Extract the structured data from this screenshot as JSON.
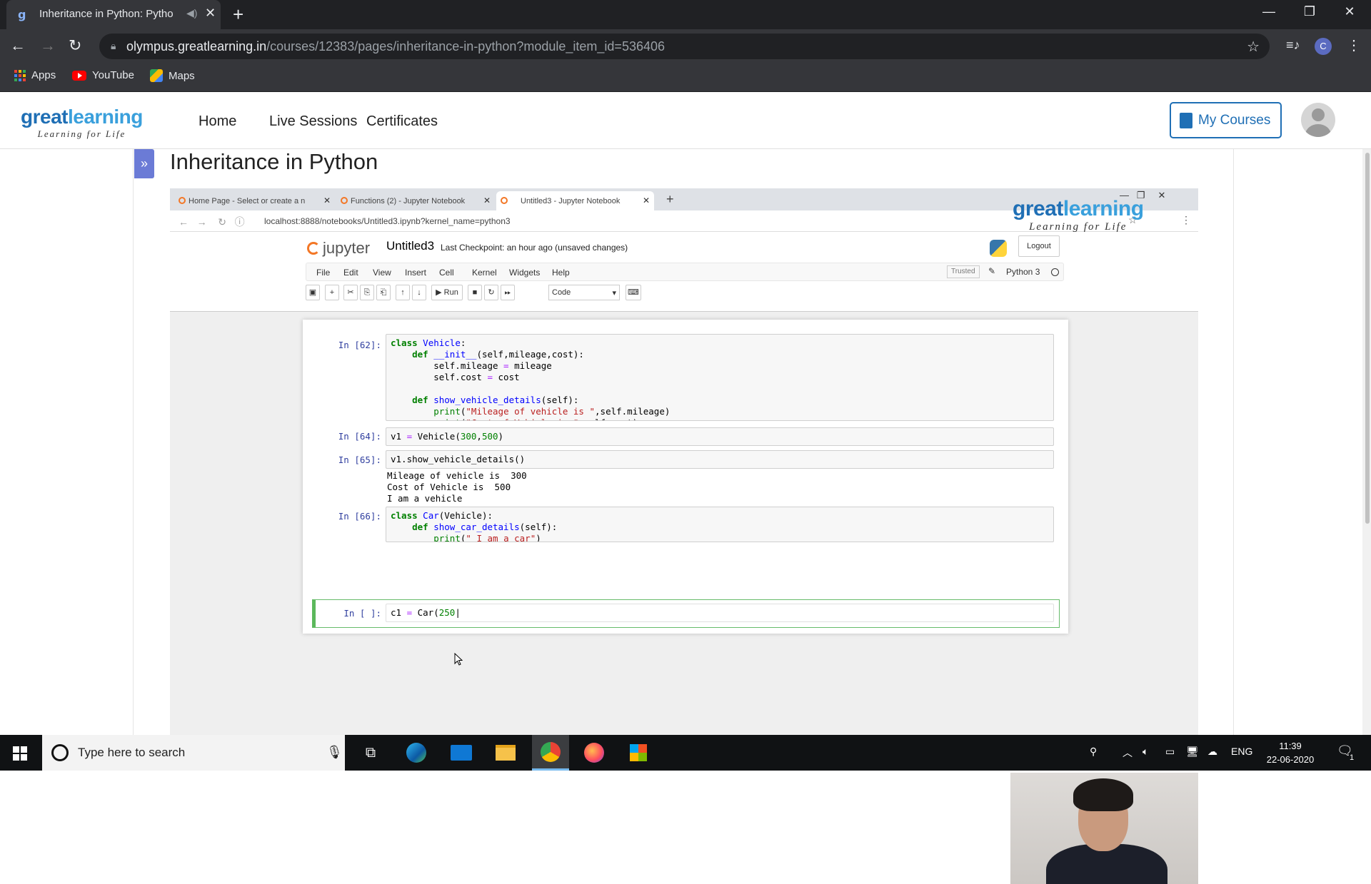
{
  "browser": {
    "active_tab_title": "Inheritance in Python: Pytho",
    "url_domain": "olympus.greatlearning.in",
    "url_path": "/courses/12383/pages/inheritance-in-python?module_item_id=536406",
    "profile_initial": "C",
    "bookmarks": [
      "Apps",
      "YouTube",
      "Maps"
    ]
  },
  "site": {
    "logo_word_1": "great",
    "logo_word_2": "learning",
    "logo_tagline": "Learning for Life",
    "nav": [
      "Home",
      "Live Sessions",
      "Certificates"
    ],
    "my_courses": "My Courses",
    "page_title": "Inheritance in Python"
  },
  "video": {
    "tabs": [
      "Home Page - Select or create a n",
      "Functions (2) - Jupyter Notebook",
      "Untitled3 - Jupyter Notebook"
    ],
    "url": "localhost:8888/notebooks/Untitled3.ipynb?kernel_name=python3",
    "watermark_word_1": "great",
    "watermark_word_2": "learning",
    "watermark_tagline": "Learning for Life",
    "jupyter_logo": "jupyter",
    "notebook_name": "Untitled3",
    "checkpoint": "Last Checkpoint: an hour ago  (unsaved changes)",
    "logout": "Logout",
    "menu": [
      "File",
      "Edit",
      "View",
      "Insert",
      "Cell",
      "Kernel",
      "Widgets",
      "Help"
    ],
    "trusted": "Trusted",
    "kernel": "Python 3",
    "run_label": "Run",
    "cell_type": "Code",
    "cells": [
      {
        "prompt": "In [62]:",
        "source": "class Vehicle:\n    def __init__(self,mileage,cost):\n        self.mileage = mileage\n        self.cost = cost\n\n    def show_vehicle_details(self):\n        print(\"Mileage of vehicle is \",self.mileage)\n        print(\"Cost of Vehicle is \",self.cost)\n        print(\"I am a vehicle\")"
      },
      {
        "prompt": "In [64]:",
        "source": "v1 = Vehicle(300,500)"
      },
      {
        "prompt": "In [65]:",
        "source": "v1.show_vehicle_details()",
        "output": "Mileage of vehicle is  300\nCost of Vehicle is  500\nI am a vehicle"
      },
      {
        "prompt": "In [66]:",
        "source": "class Car(Vehicle):\n    def show_car_details(self):\n        print(\" I am a car\")"
      },
      {
        "prompt": "In [ ]:",
        "source": "c1 = Car(250)"
      }
    ]
  },
  "taskbar": {
    "search_placeholder": "Type here to search",
    "language": "ENG",
    "time": "11:39",
    "date": "22-06-2020",
    "notifications": "1"
  }
}
